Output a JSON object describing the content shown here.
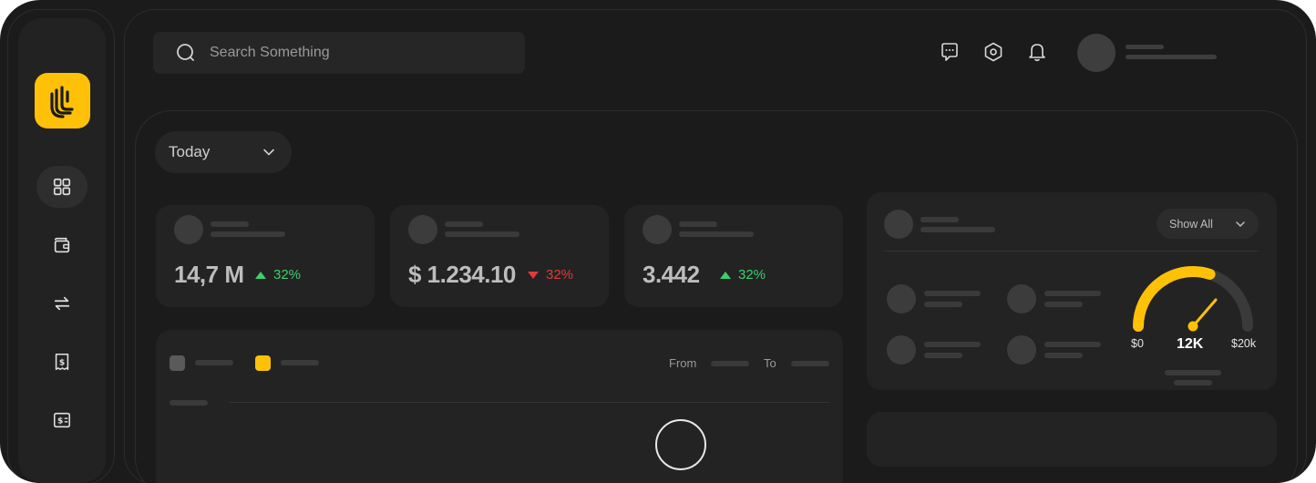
{
  "search": {
    "placeholder": "Search Something",
    "icon": "search-icon"
  },
  "topbar": {
    "icons": [
      "chat-icon",
      "settings-hexagon-icon",
      "bell-icon"
    ]
  },
  "sidebar": {
    "items": [
      {
        "icon": "dashboard-grid-icon",
        "active": true
      },
      {
        "icon": "wallet-icon",
        "active": false
      },
      {
        "icon": "transfer-arrows-icon",
        "active": false
      },
      {
        "icon": "receipt-dollar-icon",
        "active": false
      },
      {
        "icon": "dollar-exchange-icon",
        "active": false
      }
    ]
  },
  "filter": {
    "selected": "Today"
  },
  "stats": [
    {
      "value": "14,7 M",
      "change": "32%",
      "direction": "up"
    },
    {
      "value": "$ 1.234.10",
      "change": "32%",
      "direction": "down"
    },
    {
      "value": "3.442",
      "change": "32%",
      "direction": "up"
    }
  ],
  "chart_panel": {
    "from_label": "From",
    "to_label": "To"
  },
  "side_panel": {
    "show_all_label": "Show All"
  },
  "gauge": {
    "min_label": "$0",
    "max_label": "$20k",
    "value_label": "12K",
    "fraction": 0.6
  },
  "colors": {
    "accent": "#ffc107",
    "up": "#3ecf6b",
    "down": "#e13a3a",
    "background": "#1b1b1b"
  }
}
